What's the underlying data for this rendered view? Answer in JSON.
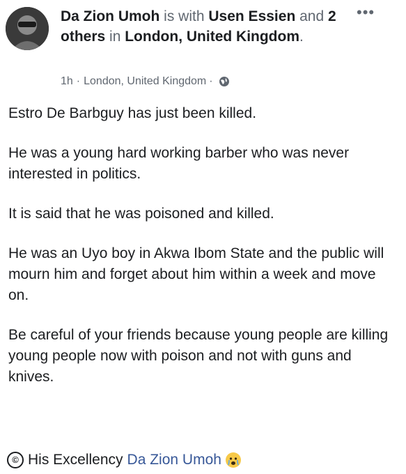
{
  "post": {
    "author": "Da Zion Umoh",
    "with_text": "is with",
    "tagged_user": "Usen Essien",
    "and_text": "and",
    "others": "2 others",
    "in_text": "in",
    "location_bold": "London, United Kingdom",
    "period": ".",
    "time": "1h",
    "meta_sep": "·",
    "meta_location": "London, United Kingdom",
    "meta_sep2": "·",
    "more_icon": "•••",
    "paragraphs": [
      "Estro De Barbguy has just been killed.",
      "He was a young hard working barber who was never interested in politics.",
      "It is said that he was poisoned and killed.",
      "He was an Uyo boy in Akwa Ibom State and the public will mourn him and forget about him within a week and move on.",
      "Be careful of your friends because young people are killing young people now with poison and not with guns and knives."
    ],
    "credit_symbol": "©",
    "credit_prefix": "His Excellency",
    "credit_name": "Da Zion Umoh"
  }
}
